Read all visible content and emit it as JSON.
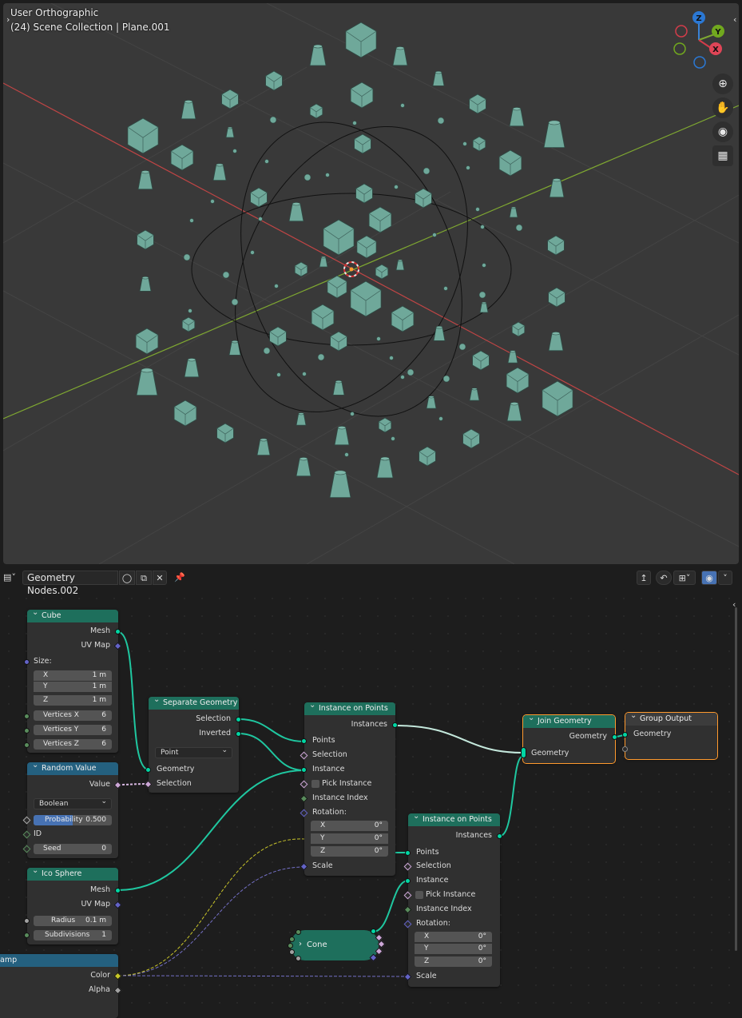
{
  "viewport": {
    "view_name": "User Orthographic",
    "collection_info": "(24) Scene Collection | Plane.001",
    "gizmo": {
      "z": "Z",
      "y": "Y",
      "x": "X"
    },
    "tools": [
      "zoom-icon",
      "hand-icon",
      "camera-icon",
      "grid-icon"
    ]
  },
  "node_editor": {
    "header": {
      "tree_name": "Geometry Nodes.002"
    },
    "nodes": {
      "cube": {
        "title": "Cube",
        "out_mesh": "Mesh",
        "out_uvmap": "UV Map",
        "size_label": "Size:",
        "x": {
          "label": "X",
          "value": "1 m"
        },
        "y": {
          "label": "Y",
          "value": "1 m"
        },
        "z": {
          "label": "Z",
          "value": "1 m"
        },
        "vx": {
          "label": "Vertices X",
          "value": "6"
        },
        "vy": {
          "label": "Vertices Y",
          "value": "6"
        },
        "vz": {
          "label": "Vertices Z",
          "value": "6"
        }
      },
      "random": {
        "title": "Random Value",
        "out_value": "Value",
        "type": "Boolean",
        "prob": {
          "label": "Probability",
          "value": "0.500",
          "fill": 0.5
        },
        "id": "ID",
        "seed": {
          "label": "Seed",
          "value": "0"
        }
      },
      "ico": {
        "title": "Ico Sphere",
        "out_mesh": "Mesh",
        "out_uvmap": "UV Map",
        "radius": {
          "label": "Radius",
          "value": "0.1 m"
        },
        "subdiv": {
          "label": "Subdivisions",
          "value": "1"
        }
      },
      "ramp": {
        "title": "amp",
        "out_color": "Color",
        "out_alpha": "Alpha"
      },
      "separate": {
        "title": "Separate Geometry",
        "out_selection": "Selection",
        "out_inverted": "Inverted",
        "domain": "Point",
        "in_geometry": "Geometry",
        "in_selection": "Selection"
      },
      "iop1": {
        "title": "Instance on Points",
        "out_instances": "Instances",
        "points": "Points",
        "selection": "Selection",
        "instance": "Instance",
        "pick": "Pick Instance",
        "index": "Instance Index",
        "rotation": "Rotation:",
        "rx": {
          "label": "X",
          "value": "0°"
        },
        "ry": {
          "label": "Y",
          "value": "0°"
        },
        "rz": {
          "label": "Z",
          "value": "0°"
        },
        "scale": "Scale"
      },
      "iop2": {
        "title": "Instance on Points",
        "out_instances": "Instances",
        "points": "Points",
        "selection": "Selection",
        "instance": "Instance",
        "pick": "Pick Instance",
        "index": "Instance Index",
        "rotation": "Rotation:",
        "rx": {
          "label": "X",
          "value": "0°"
        },
        "ry": {
          "label": "Y",
          "value": "0°"
        },
        "rz": {
          "label": "Z",
          "value": "0°"
        },
        "scale": "Scale"
      },
      "join": {
        "title": "Join Geometry",
        "out_geometry": "Geometry",
        "in_geometry": "Geometry"
      },
      "output": {
        "title": "Group Output",
        "in_geometry": "Geometry"
      },
      "cone": {
        "title": "Cone"
      }
    }
  },
  "colors": {
    "geometry_socket": "#00d6a3",
    "vector_socket": "#6363c7",
    "boolean_socket": "#cca6d6",
    "color_socket": "#c7c729",
    "mesh_color": "#6fa89a",
    "node_header_geometry": "#1e6f5c",
    "node_header_input": "#24607f"
  }
}
